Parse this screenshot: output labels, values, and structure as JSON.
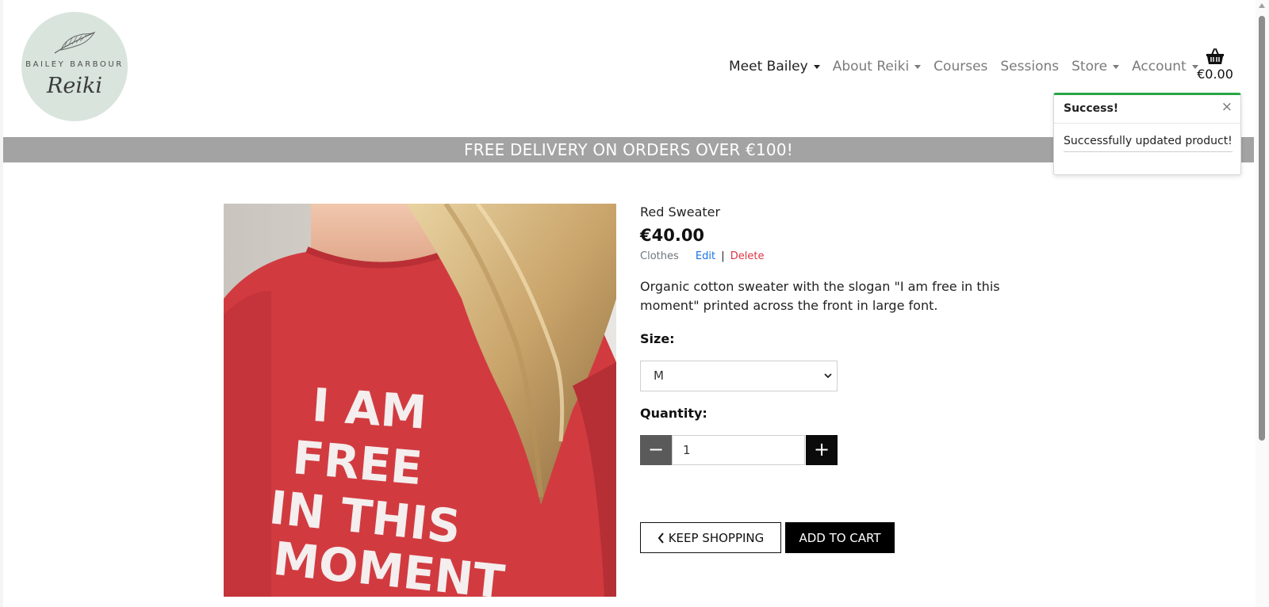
{
  "logo": {
    "top_text": "BAILEY BARBOUR",
    "script_text": "Reiki"
  },
  "nav": {
    "items": [
      {
        "label": "Meet Bailey",
        "dropdown": true
      },
      {
        "label": "About Reiki",
        "dropdown": true
      },
      {
        "label": "Courses",
        "dropdown": false
      },
      {
        "label": "Sessions",
        "dropdown": false
      },
      {
        "label": "Store",
        "dropdown": true
      },
      {
        "label": "Account",
        "dropdown": true
      }
    ],
    "basket_icon": "basket-icon",
    "basket_total": "€0.00"
  },
  "banner": {
    "text": "FREE DELIVERY ON ORDERS OVER €100!"
  },
  "toast": {
    "title": "Success!",
    "close": "×",
    "message": "Successfully updated product!",
    "accent_color": "#28a745"
  },
  "product": {
    "image_icon": "product-photo",
    "shirt_text": [
      "I AM",
      "FREE",
      "IN THIS",
      "MOMENT"
    ],
    "name": "Red Sweater",
    "price": "€40.00",
    "category": "Clothes",
    "edit_label": "Edit",
    "separator": "|",
    "delete_label": "Delete",
    "description": "Organic cotton sweater with the slogan \"I am free in this moment\" printed across the front in large font.",
    "size_label": "Size:",
    "size_selected": "M",
    "quantity_label": "Quantity:",
    "quantity_value": "1",
    "minus_label": "−",
    "plus_label": "+",
    "keep_shopping_label": "KEEP SHOPPING",
    "add_to_cart_label": "ADD TO CART"
  },
  "colors": {
    "banner_bg": "#a3a3a3",
    "edit_link": "#1a73e8",
    "delete_link": "#dc3545",
    "logo_bg": "#d8e4dc"
  }
}
